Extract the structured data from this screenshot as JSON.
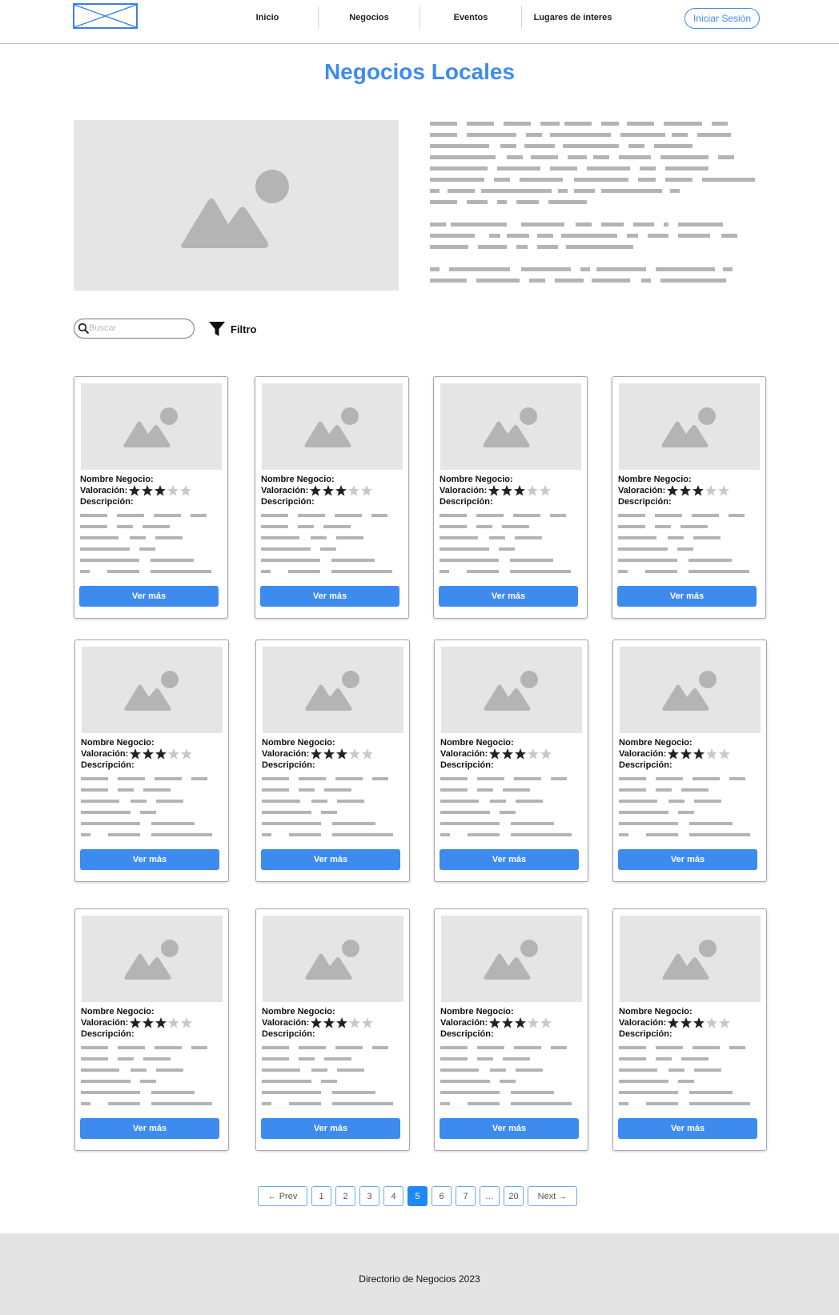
{
  "header": {
    "nav": [
      "Inicio",
      "Negocios",
      "Eventos",
      "Lugares de interes"
    ],
    "login_label": "Iniciar Sesión"
  },
  "page": {
    "title": "Negocios Locales"
  },
  "toolbar": {
    "search_placeholder": "Buscar",
    "filter_label": "Filtro"
  },
  "card_template": {
    "name_label": "Nombre Negocio:",
    "rating_label": "Valoración:",
    "description_label": "Descripción:",
    "button_label": "Ver más",
    "rating": 3,
    "rating_max": 5
  },
  "card_count": 12,
  "pagination": {
    "prev": "← Prev",
    "pages": [
      "1",
      "2",
      "3",
      "4",
      "5",
      "6",
      "7",
      "…",
      "20"
    ],
    "active": "5",
    "next": "Next →"
  },
  "footer": {
    "text": "Directorio de Negocios 2023"
  },
  "colors": {
    "accent": "#3d8bef",
    "active_page": "#1e88f5",
    "placeholder_bg": "#e5e5e5",
    "placeholder_shape": "#b4b4b4",
    "star_filled": "#222222",
    "star_empty": "#c8c8c8"
  },
  "icons": [
    "logo-placeholder",
    "image-placeholder-icon",
    "search-icon",
    "filter-icon",
    "star-icon"
  ]
}
